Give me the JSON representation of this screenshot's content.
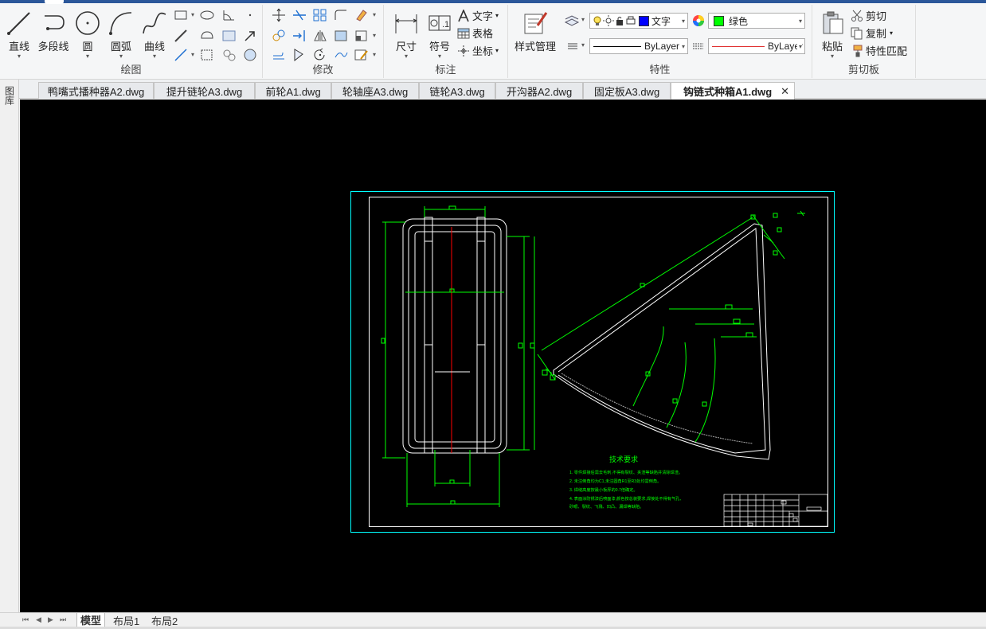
{
  "ribbon": {
    "groups": {
      "draw": {
        "label": "绘图",
        "line": "直线",
        "polyline": "多段线",
        "circle": "圆",
        "arc": "圆弧",
        "curve": "曲线"
      },
      "modify": {
        "label": "修改"
      },
      "annotate": {
        "label": "标注",
        "dimension": "尺寸",
        "symbol": "符号",
        "text": "文字",
        "table": "表格",
        "coordinate": "坐标"
      },
      "properties": {
        "label": "特性",
        "style_manager": "样式管理",
        "layer_name": "文字",
        "color_value": "绿色",
        "linetype_value": "ByLayer",
        "lineweight_value": "ByLayer"
      },
      "clipboard": {
        "label": "剪切板",
        "paste": "粘贴",
        "cut": "剪切",
        "copy": "复制",
        "match_properties": "特性匹配"
      }
    }
  },
  "doc_tabs": [
    {
      "label": "鸭嘴式播种器A2.dwg"
    },
    {
      "label": "提升链轮A3.dwg"
    },
    {
      "label": "前轮A1.dwg"
    },
    {
      "label": "轮轴座A3.dwg"
    },
    {
      "label": "链轮A3.dwg"
    },
    {
      "label": "开沟器A2.dwg"
    },
    {
      "label": "固定板A3.dwg"
    },
    {
      "label": "钩链式种箱A1.dwg",
      "active": true
    }
  ],
  "left_panel": {
    "label": "图库"
  },
  "drawing": {
    "notes_title": "技术要求",
    "notes": [
      "1. 零件焊接后需去毛刺,不得有裂纹、夹渣等缺陷并清除焊渣。",
      "2. 未注倒角均为C1,未注圆角R1至R3处均需倒角。",
      "3. 焊缝高度按最小板厚的0.7倍确定。",
      "4. 表面涂防锈漆后喷面漆,颜色按总装要求,焊接处不得有气孔、",
      "砂眼、裂纹、飞溅、凹凸、漏焊等缺陷。"
    ]
  },
  "layout_tabs": [
    {
      "label": "模型",
      "active": true
    },
    {
      "label": "布局1"
    },
    {
      "label": "布局2"
    }
  ],
  "colors": {
    "accent": "#2b579a",
    "canvas": "#000000",
    "cad_white": "#ffffff",
    "cad_green": "#00ff00",
    "cad_cyan": "#00ffff",
    "cad_red": "#ff0000",
    "layer_color_swatch": "#00ff00",
    "layer_swatch_blue": "#0000ff"
  }
}
